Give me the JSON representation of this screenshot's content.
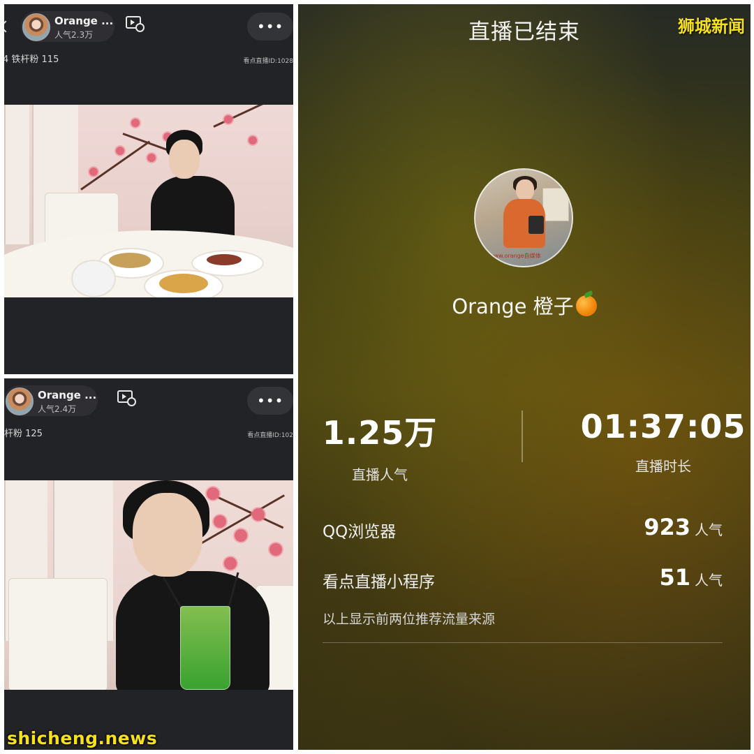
{
  "panel_top": {
    "host_name": "Orange ...",
    "popularity": "人气2.3万",
    "fans_text": "4 铁杆粉 115",
    "live_id": "看点直播ID:1028"
  },
  "panel_bottom": {
    "host_name": "Orange ...",
    "popularity": "人气2.4万",
    "fans_text": "杆粉 125",
    "live_id": "看点直播ID:102"
  },
  "watermark_bottom": "shicheng.news",
  "end_screen": {
    "title": "直播已结束",
    "brand_watermark": "狮城新闻",
    "streamer_name": "Orange 橙子",
    "avatar_caption": "www.orange自媒体",
    "stats": [
      {
        "value": "1.25万",
        "label": "直播人气"
      },
      {
        "value": "01:37:05",
        "label": "直播时长"
      }
    ],
    "sources": [
      {
        "name": "QQ浏览器",
        "count": "923",
        "unit": "人气"
      },
      {
        "name": "看点直播小程序",
        "count": "51",
        "unit": "人气"
      }
    ],
    "note": "以上显示前两位推荐流量来源"
  },
  "icons": {
    "more": "more-dots-icon",
    "video": "video-record-icon",
    "emoji": "orange-emoji-icon"
  }
}
